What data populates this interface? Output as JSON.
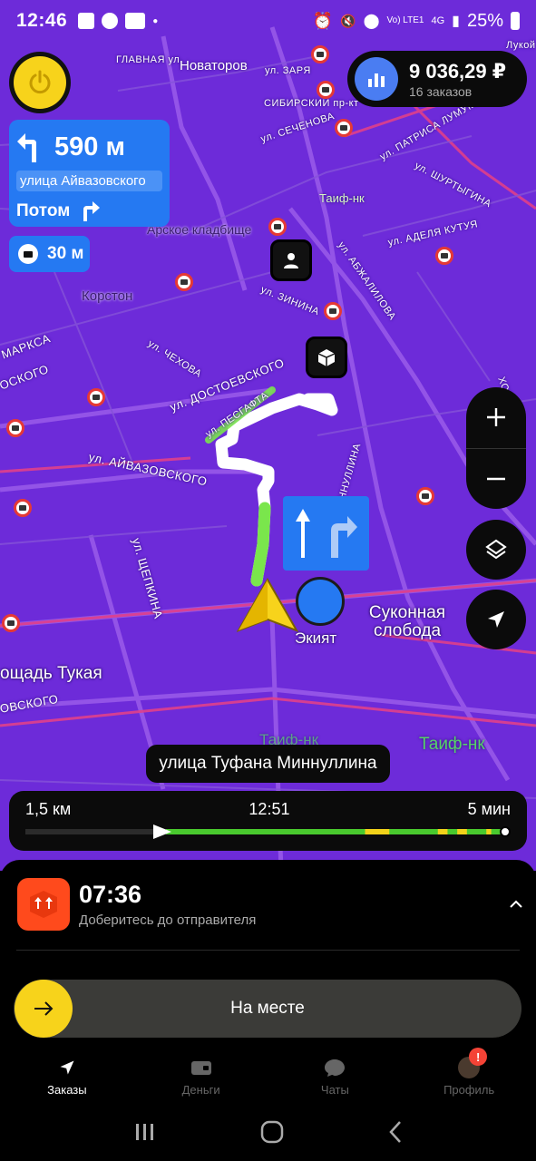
{
  "status_bar": {
    "time": "12:46",
    "battery": "25%",
    "network": "4G",
    "volte": "Vo) LTE1"
  },
  "map": {
    "streets": [
      "ул. Новаторов",
      "Новаторов",
      "ул. ЗАРЯ",
      "СИБИРСКИЙ пр-кт",
      "ул. СЕЧЕНОВА",
      "ул. ПАТРИСА ЛУМУМБЫ",
      "ул. ШУРТЫГИНА",
      "ул. АДЕЛЯ КУТУЯ",
      "ул. АБЖАЛИЛОВА",
      "ул. ЗИНИНА",
      "ул. ЧЕХОВА",
      "ул. ДОСТОЕВСКОГО",
      "ул. ПЕСГАФТА",
      "ул. АЙВАЗОВСКОГО",
      "ул. ЩЕПКИНА",
      "МИННУЛЛИНА",
      "ХОРОВА",
      "МАРКСА",
      "ОСКОГО",
      "ОВСКОГО",
      "Лукой",
      "ГЛАВНАЯ ул."
    ],
    "places": {
      "cemetery": "Арское кладбище",
      "korston": "Корстон",
      "taif_top": "Таиф-нк",
      "tukay": "ощадь Тукая",
      "ekiyat": "Экият",
      "sukonnaya": "Суконная слобода",
      "taif_bottom": "Таиф-нк",
      "taif_bottom2": "Таиф-нк"
    }
  },
  "earnings": {
    "amount": "9 036,29 ₽",
    "orders": "16 заказов"
  },
  "maneuver": {
    "distance": "590 м",
    "street": "улица Айвазовского",
    "then_label": "Потом"
  },
  "camera": {
    "distance": "30 м"
  },
  "current_street": "улица Туфана Миннуллина",
  "route": {
    "distance": "1,5 км",
    "arrival": "12:51",
    "duration": "5 мин",
    "progress": 0.29
  },
  "order": {
    "eta": "07:36",
    "subtitle": "Доберитесь до отправителя",
    "arrive_label": "На месте"
  },
  "tabs": [
    {
      "label": "Заказы",
      "icon": "navigation-arrow-icon",
      "active": true
    },
    {
      "label": "Деньги",
      "icon": "wallet-icon",
      "active": false
    },
    {
      "label": "Чаты",
      "icon": "chat-bubble-icon",
      "active": false
    },
    {
      "label": "Профиль",
      "icon": "avatar",
      "active": false,
      "badge": "!"
    }
  ],
  "colors": {
    "map_bg": "#6d2bd9",
    "accent_yellow": "#f7d31b",
    "maneuver_blue": "#2579f2",
    "route_green": "#49c92e",
    "traffic_yellow": "#f2d21a",
    "order_orange": "#ff4a1c"
  }
}
